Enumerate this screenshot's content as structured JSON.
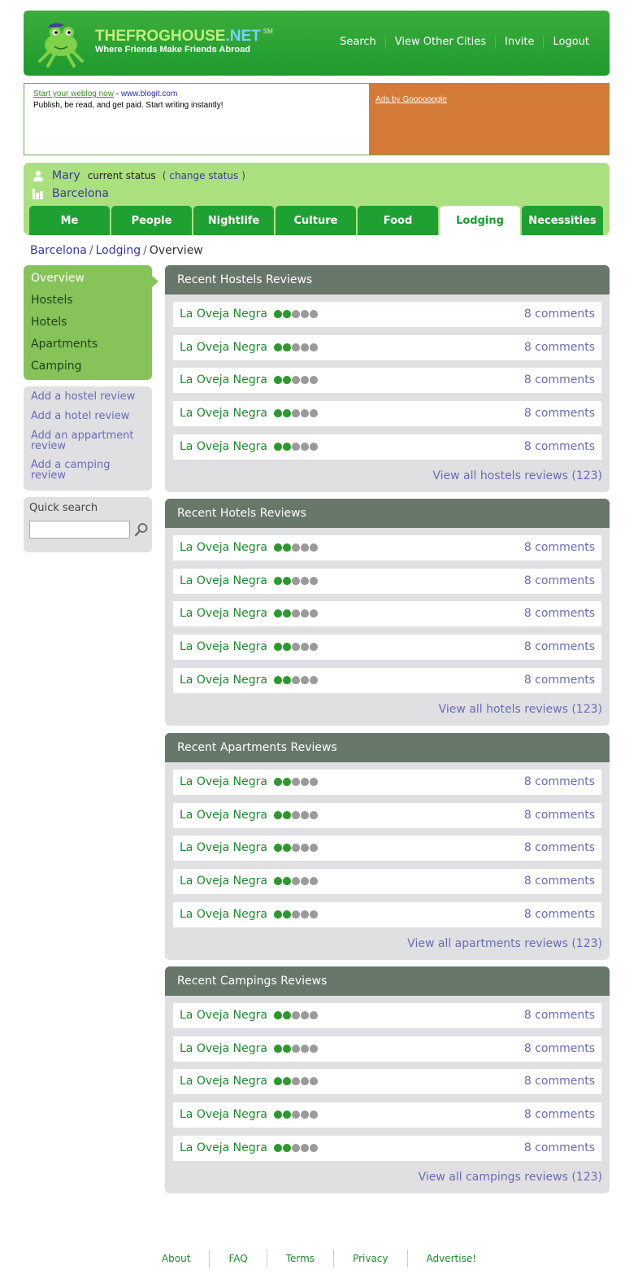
{
  "header": {
    "brand_main": "THEFROGHOUSE",
    "brand_tld": ".NET",
    "brand_mark": "SM",
    "tagline": "Where Friends Make Friends Abroad",
    "nav": [
      "Search",
      "View Other Cities",
      "Invite",
      "Logout"
    ]
  },
  "ad": {
    "link_text": "Start your weblog now",
    "separator": " - ",
    "domain": "www.blogit.com",
    "body": "Publish, be read, and get paid. Start writing instantly!",
    "ads_by": "Ads by Goooooogle"
  },
  "profile": {
    "name": "Mary",
    "status_label": "current status",
    "change_open": "(",
    "change_label": "change status",
    "change_close": ")",
    "city": "Barcelona"
  },
  "tabs": [
    "Me",
    "People",
    "Nightlife",
    "Culture",
    "Food",
    "Lodging",
    "Necessities"
  ],
  "active_tab": "Lodging",
  "breadcrumb": {
    "city": "Barcelona",
    "section": "Lodging",
    "current": "Overview",
    "sep": "/"
  },
  "sidebar": {
    "nav": [
      "Overview",
      "Hostels",
      "Hotels",
      "Apartments",
      "Camping"
    ],
    "add_links": [
      "Add a hostel review",
      "Add a hotel review",
      "Add an appartment review",
      "Add a camping review"
    ],
    "quick_search_label": "Quick search",
    "quick_search_value": ""
  },
  "panels": [
    {
      "title": "Recent Hostels Reviews",
      "items": [
        {
          "name": "La Oveja Negra",
          "rating": 2,
          "comments": "8 comments"
        },
        {
          "name": "La Oveja Negra",
          "rating": 2,
          "comments": "8 comments"
        },
        {
          "name": "La Oveja Negra",
          "rating": 2,
          "comments": "8 comments"
        },
        {
          "name": "La Oveja Negra",
          "rating": 2,
          "comments": "8 comments"
        },
        {
          "name": "La Oveja Negra",
          "rating": 2,
          "comments": "8 comments"
        }
      ],
      "view_all": "View all hostels reviews (123)"
    },
    {
      "title": "Recent Hotels Reviews",
      "items": [
        {
          "name": "La Oveja Negra",
          "rating": 2,
          "comments": "8 comments"
        },
        {
          "name": "La Oveja Negra",
          "rating": 2,
          "comments": "8 comments"
        },
        {
          "name": "La Oveja Negra",
          "rating": 2,
          "comments": "8 comments"
        },
        {
          "name": "La Oveja Negra",
          "rating": 2,
          "comments": "8 comments"
        },
        {
          "name": "La Oveja Negra",
          "rating": 2,
          "comments": "8 comments"
        }
      ],
      "view_all": "View all hotels reviews (123)"
    },
    {
      "title": "Recent Apartments Reviews",
      "items": [
        {
          "name": "La Oveja Negra",
          "rating": 2,
          "comments": "8 comments"
        },
        {
          "name": "La Oveja Negra",
          "rating": 2,
          "comments": "8 comments"
        },
        {
          "name": "La Oveja Negra",
          "rating": 2,
          "comments": "8 comments"
        },
        {
          "name": "La Oveja Negra",
          "rating": 2,
          "comments": "8 comments"
        },
        {
          "name": "La Oveja Negra",
          "rating": 2,
          "comments": "8 comments"
        }
      ],
      "view_all": "View all apartments reviews (123)"
    },
    {
      "title": "Recent Campings Reviews",
      "items": [
        {
          "name": "La Oveja Negra",
          "rating": 2,
          "comments": "8 comments"
        },
        {
          "name": "La Oveja Negra",
          "rating": 2,
          "comments": "8 comments"
        },
        {
          "name": "La Oveja Negra",
          "rating": 2,
          "comments": "8 comments"
        },
        {
          "name": "La Oveja Negra",
          "rating": 2,
          "comments": "8 comments"
        },
        {
          "name": "La Oveja Negra",
          "rating": 2,
          "comments": "8 comments"
        }
      ],
      "view_all": "View all campings reviews (123)"
    }
  ],
  "rating_max": 5,
  "footer": [
    "About",
    "FAQ",
    "Terms",
    "Privacy",
    "Advertise!"
  ],
  "colors": {
    "brand_green": "#1e9a2e",
    "profile_green": "#abe07f",
    "panel_header": "#67776a",
    "link_purple": "#6a6ab8",
    "ad_orange": "#d47a38"
  }
}
